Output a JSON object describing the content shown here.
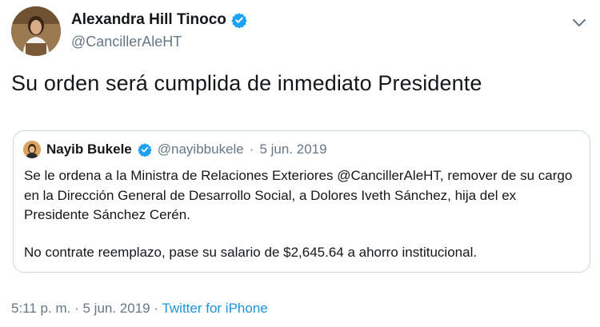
{
  "author": {
    "name": "Alexandra Hill Tinoco",
    "handle": "@CancillerAleHT",
    "verified_icon": "verified-badge-icon",
    "accent": "#1da1f2"
  },
  "tweet": {
    "text": "Su orden será cumplida de inmediato Presidente"
  },
  "quoted": {
    "name": "Nayib Bukele",
    "handle": "@nayibbukele",
    "separator": "·",
    "date": "5 jun. 2019",
    "paragraph1": "Se le ordena a la Ministra de Relaciones Exteriores @CancillerAleHT, remover de su cargo en la Dirección General de Desarrollo Social, a Dolores Iveth Sánchez, hija del ex Presidente Sánchez Cerén.",
    "paragraph2": "No contrate reemplazo, pase su salario de $2,645.64 a ahorro institucional."
  },
  "meta": {
    "time": "5:11 p. m.",
    "sep1": "·",
    "date": "5 jun. 2019",
    "sep2": "·",
    "source": "Twitter for iPhone",
    "link_color": "#1b95e0"
  },
  "menu_icon": "chevron-down-icon"
}
